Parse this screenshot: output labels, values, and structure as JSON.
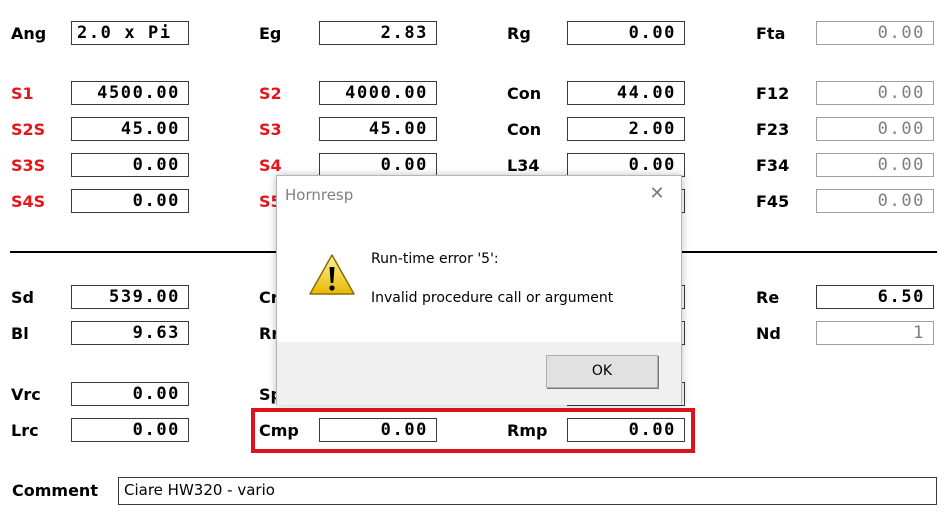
{
  "labels": {
    "ang": "Ang",
    "eg": "Eg",
    "rg": "Rg",
    "fta": "Fta",
    "s1": "S1",
    "s2": "S2",
    "con1": "Con",
    "f12": "F12",
    "s2s": "S2S",
    "s3": "S3",
    "con2": "Con",
    "f23": "F23",
    "s3s": "S3S",
    "s4": "S4",
    "l34": "L34",
    "f34": "F34",
    "s4s": "S4S",
    "s5": "S5",
    "f45": "F45",
    "sd": "Sd",
    "cr": "Cr",
    "re": "Re",
    "bl": "Bl",
    "rr": "Rr",
    "nd": "Nd",
    "vrc": "Vrc",
    "sp": "Sp",
    "lrc": "Lrc",
    "cmp": "Cmp",
    "rmp": "Rmp",
    "comment": "Comment"
  },
  "values": {
    "ang": "2.0 x Pi",
    "eg": "2.83",
    "rg": "0.00",
    "fta": "0.00",
    "s1": "4500.00",
    "s2": "4000.00",
    "con1": "44.00",
    "f12": "0.00",
    "s2s": "45.00",
    "s3": "45.00",
    "con2": "2.00",
    "f23": "0.00",
    "s3s": "0.00",
    "s4": "0.00",
    "l34": "0.00",
    "f34": "0.00",
    "s4s": "0.00",
    "f45": "0.00",
    "sd": "539.00",
    "re": "6.50",
    "bl": "9.63",
    "nd": "1",
    "vrc": "0.00",
    "lrc": "0.00",
    "cmp": "0.00",
    "rmp": "0.00",
    "comment": "Ciare HW320 - vario"
  },
  "dialog": {
    "title": "Hornresp",
    "close": "✕",
    "line1": "Run-time error '5':",
    "line2": "Invalid procedure call or argument",
    "ok": "OK"
  },
  "colors": {
    "red_label": "#e8141b",
    "highlight": "#e0121c"
  }
}
